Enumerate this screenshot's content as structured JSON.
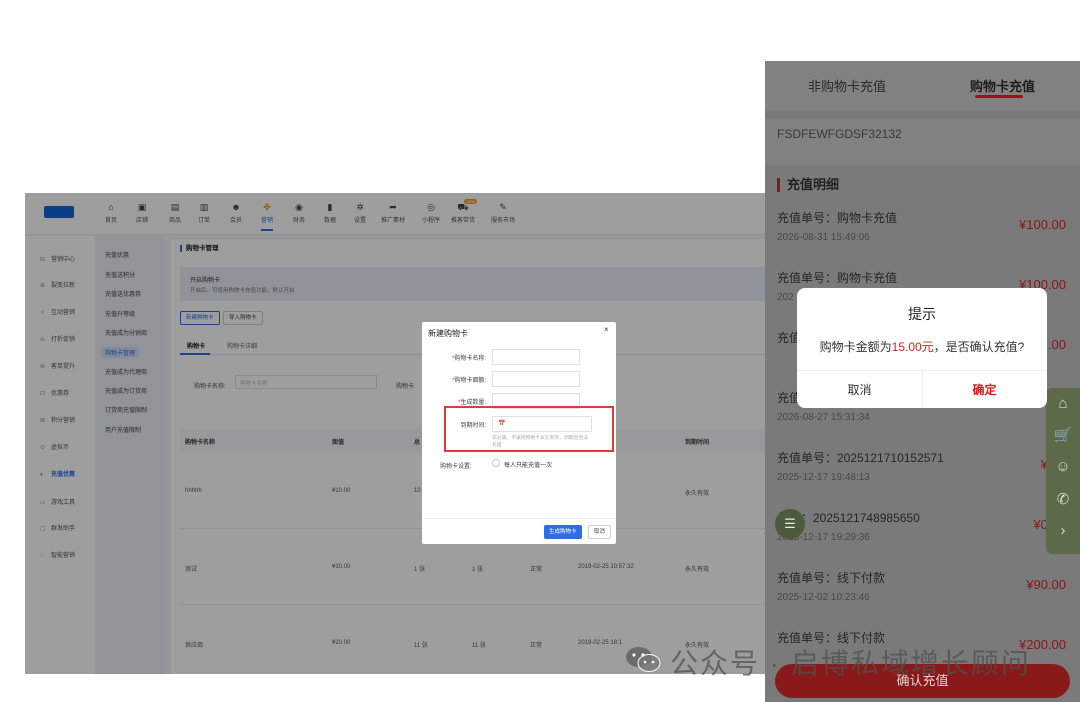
{
  "admin": {
    "topnav": [
      {
        "icon": "home-icon",
        "glyph": "⌂",
        "label": "首页"
      },
      {
        "icon": "store-icon",
        "glyph": "▣",
        "label": "店铺"
      },
      {
        "icon": "goods-icon",
        "glyph": "▤",
        "label": "商品"
      },
      {
        "icon": "order-icon",
        "glyph": "▥",
        "label": "订单"
      },
      {
        "icon": "member-icon",
        "glyph": "☻",
        "label": "会员"
      },
      {
        "icon": "marketing-icon",
        "glyph": "✤",
        "label": "营销"
      },
      {
        "icon": "finance-icon",
        "glyph": "◉",
        "label": "财务"
      },
      {
        "icon": "data-icon",
        "glyph": "▮",
        "label": "数据"
      },
      {
        "icon": "settings-icon",
        "glyph": "✲",
        "label": "设置"
      },
      {
        "icon": "share-icon",
        "glyph": "➦",
        "label": "推广素材"
      },
      {
        "icon": "miniprogram-icon",
        "glyph": "◎",
        "label": "小程序"
      },
      {
        "icon": "truck-icon",
        "glyph": "⛟",
        "label": "推客带货",
        "badge": "NEW"
      },
      {
        "icon": "market-icon",
        "glyph": "✎",
        "label": "服务市场"
      }
    ],
    "side1": [
      {
        "icon": "marketing-center-icon",
        "glyph": "⊟",
        "label": "营销中心"
      },
      {
        "icon": "fission-icon",
        "glyph": "⊕",
        "label": "裂变拉新"
      },
      {
        "icon": "interaction-icon",
        "glyph": "✧",
        "label": "互动营销"
      },
      {
        "icon": "discount-icon",
        "glyph": "⊖",
        "label": "打折促销"
      },
      {
        "icon": "order-boost-icon",
        "glyph": "⊗",
        "label": "客单提升"
      },
      {
        "icon": "coupon-icon",
        "glyph": "⊡",
        "label": "优惠券"
      },
      {
        "icon": "points-icon",
        "glyph": "⊠",
        "label": "积分营销"
      },
      {
        "icon": "virtual-coin-icon",
        "glyph": "⊙",
        "label": "虚拟币"
      },
      {
        "icon": "recharge-icon",
        "glyph": "◐",
        "label": "充值优惠"
      },
      {
        "icon": "game-icon",
        "glyph": "▭",
        "label": "游戏工具"
      },
      {
        "icon": "mass-send-icon",
        "glyph": "▢",
        "label": "群发助手"
      },
      {
        "icon": "smart-marketing-icon",
        "glyph": "◌",
        "label": "智能营销"
      }
    ],
    "side2": [
      "充值优惠",
      "充值送积分",
      "充值送优惠券",
      "充值升等级",
      "充值成为分销商",
      "购物卡管理",
      "充值成为代理商",
      "充值成为订货商",
      "订货商充值限制",
      "用户充值限制"
    ],
    "page_title": "购物卡管理",
    "notice": {
      "title": "开启购物卡",
      "desc": "开启后，可使用购物卡充值功能，默认开启"
    },
    "buttons": {
      "new_card": "新建购物卡",
      "import_card": "导入购物卡"
    },
    "tabs": [
      "购物卡",
      "购物卡详细"
    ],
    "filter": {
      "label": "购物卡名称:",
      "placeholder": "购物卡名称",
      "label2": "购物卡"
    },
    "table": {
      "headers": [
        "购物卡名称",
        "面值",
        "总",
        "到期时间"
      ],
      "rows": [
        {
          "name": "hhhhh",
          "value": "¥10.00",
          "total": "10",
          "remain": "",
          "status": "",
          "created": "09:39:04",
          "expire": "永久有效"
        },
        {
          "name": "测试",
          "value": "¥10.00",
          "total": "1 张",
          "remain": "1 张",
          "status": "正常",
          "created": "2019-02-25 10:57:32",
          "expire": "永久有效"
        },
        {
          "name": "供应商",
          "value": "¥20.00",
          "total": "11 张",
          "remain": "11 张",
          "status": "正常",
          "created": "2019-02-25 18:1",
          "expire": "永久有效"
        }
      ]
    },
    "modal": {
      "title": "新建购物卡",
      "close": "×",
      "fields": [
        {
          "label": "购物卡名称:",
          "required": true
        },
        {
          "label": "购物卡面额:",
          "required": true
        },
        {
          "label": "生成数量:",
          "required": true
        }
      ],
      "expire_label": "到期时间:",
      "date_icon": "📅",
      "expire_hint": "非必填，不填则购物卡永久有效，到期后无法充值",
      "setting_label": "购物卡设置:",
      "setting_option": "每人只能充值一次",
      "generate_btn": "生成购物卡",
      "cancel_btn": "取消"
    }
  },
  "mobile": {
    "tabs": [
      "非购物卡充值",
      "购物卡充值"
    ],
    "card_no": "FSDFEWFGDSF32132",
    "section_title": "充值明细",
    "records": [
      {
        "title": "充值单号：购物卡充值",
        "time": "2026-08-31 15:49:06",
        "amount": "¥100.00"
      },
      {
        "title": "充值单号：购物卡充值",
        "time": "202",
        "amount": "¥100.00"
      },
      {
        "title": "充值",
        "time": "",
        "amount": ".00"
      },
      {
        "title": "充值",
        "time": "2026-08-27 15:31:34",
        "amount": ""
      },
      {
        "title": "充值单号：2025121710152571",
        "time": "2025-12-17 19:48:13",
        "amount": "¥0.0"
      },
      {
        "title": "单号：2025121748985650",
        "time": "2025-12-17 19:29:36",
        "amount": "¥0.01"
      },
      {
        "title": "充值单号：线下付款",
        "time": "2025-12-02 10:23:46",
        "amount": "¥90.00"
      },
      {
        "title": "充值单号：线下付款",
        "time": "",
        "amount": "¥200.00"
      }
    ],
    "dialog": {
      "title": "提示",
      "msg_prefix": "购物卡金额为",
      "msg_amount": "15.00元",
      "msg_suffix": "，是否确认充值?",
      "cancel": "取消",
      "confirm": "确定"
    },
    "float_icons": [
      {
        "icon": "home-icon",
        "glyph": "⌂"
      },
      {
        "icon": "cart-icon",
        "glyph": "🛒"
      },
      {
        "icon": "user-icon",
        "glyph": "☺"
      },
      {
        "icon": "phone-icon",
        "glyph": "✆"
      },
      {
        "icon": "arrow-right-icon",
        "glyph": "›"
      }
    ],
    "round_icon": {
      "icon": "search-list-icon",
      "glyph": "☰"
    },
    "bottom_button": "确认充值"
  },
  "watermark": {
    "text": "公众号 · 启博私域增长顾问",
    "icon": "wechat-icon"
  }
}
